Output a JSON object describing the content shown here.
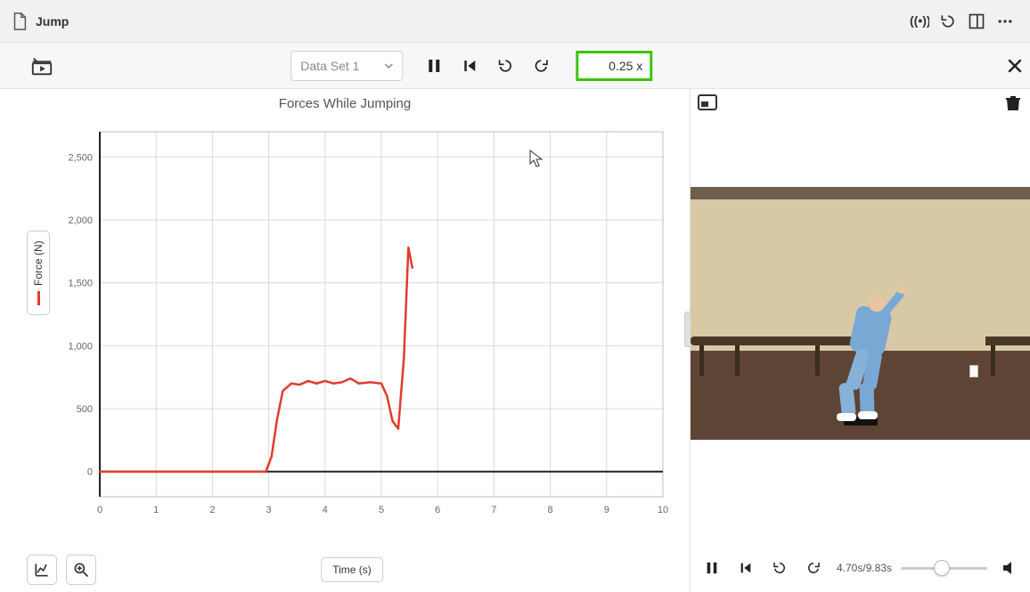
{
  "app": {
    "title": "Jump"
  },
  "toolbar": {
    "dataset_label": "Data Set 1",
    "rate": "0.25 x"
  },
  "chart": {
    "title": "Forces While Jumping",
    "xlabel": "Time (s)",
    "ylabel": "Force (N)"
  },
  "video": {
    "time_label": "4.70s/9.83s",
    "current_s": 4.7,
    "total_s": 9.83
  },
  "chart_data": {
    "type": "line",
    "title": "Forces While Jumping",
    "xlabel": "Time (s)",
    "ylabel": "Force (N)",
    "xlim": [
      0,
      10
    ],
    "ylim": [
      -200,
      2700
    ],
    "x_ticks": [
      0,
      1,
      2,
      3,
      4,
      5,
      6,
      7,
      8,
      9,
      10
    ],
    "y_ticks": [
      0,
      500,
      1000,
      1500,
      2000,
      2500
    ],
    "series": [
      {
        "name": "Force (N)",
        "color": "#e33b2e",
        "x": [
          0.0,
          2.95,
          3.05,
          3.15,
          3.25,
          3.4,
          3.55,
          3.7,
          3.85,
          4.0,
          4.15,
          4.3,
          4.45,
          4.6,
          4.8,
          5.0,
          5.1,
          5.2,
          5.3,
          5.4,
          5.48,
          5.55
        ],
        "y": [
          0,
          0,
          120,
          420,
          640,
          700,
          690,
          720,
          700,
          720,
          700,
          710,
          740,
          700,
          710,
          700,
          600,
          400,
          340,
          900,
          1780,
          1620
        ]
      }
    ]
  }
}
